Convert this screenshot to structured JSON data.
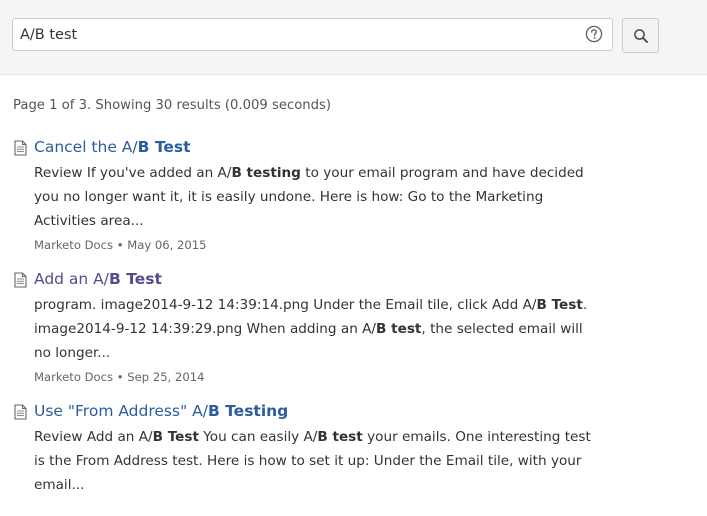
{
  "search": {
    "query": "A/B test",
    "help_icon": "question-circle-icon",
    "button_icon": "search-icon"
  },
  "summary": "Page 1 of 3. Showing 30 results (0.009 seconds)",
  "colors": {
    "link": "#2a5d9f",
    "visited_link": "#5a4a8a",
    "header_bg": "#f5f5f5"
  },
  "results": [
    {
      "icon": "document-icon",
      "title": [
        {
          "text": "Cancel the A/",
          "bold": false
        },
        {
          "text": "B Test",
          "bold": true
        }
      ],
      "snippet": [
        {
          "text": "Review If you've added an A/",
          "bold": false
        },
        {
          "text": "B testing",
          "bold": true
        },
        {
          "text": " to your email program and have decided you no longer want it, it is easily undone. Here is how: Go to the Marketing Activities area...",
          "bold": false
        }
      ],
      "meta": "Marketo Docs • May 06, 2015",
      "visited": false
    },
    {
      "icon": "document-icon",
      "title": [
        {
          "text": "Add an A/",
          "bold": false
        },
        {
          "text": "B Test",
          "bold": true
        }
      ],
      "snippet": [
        {
          "text": "program. image2014-9-12 14:39:14.png Under the Email tile, click Add A/",
          "bold": false
        },
        {
          "text": "B Test",
          "bold": true
        },
        {
          "text": ". image2014-9-12 14:39:29.png When adding an A/",
          "bold": false
        },
        {
          "text": "B test",
          "bold": true
        },
        {
          "text": ", the selected email will no longer...",
          "bold": false
        }
      ],
      "meta": "Marketo Docs • Sep 25, 2014",
      "visited": true
    },
    {
      "icon": "document-icon",
      "title": [
        {
          "text": "Use \"From Address\" A/",
          "bold": false
        },
        {
          "text": "B Testing",
          "bold": true
        }
      ],
      "snippet": [
        {
          "text": "Review Add an A/",
          "bold": false
        },
        {
          "text": "B Test",
          "bold": true
        },
        {
          "text": " You can easily A/",
          "bold": false
        },
        {
          "text": "B test",
          "bold": true
        },
        {
          "text": " your emails. One interesting test is the From Address test. Here is how to set it up: Under the Email tile, with your email...",
          "bold": false
        }
      ],
      "meta": "",
      "visited": false
    }
  ]
}
